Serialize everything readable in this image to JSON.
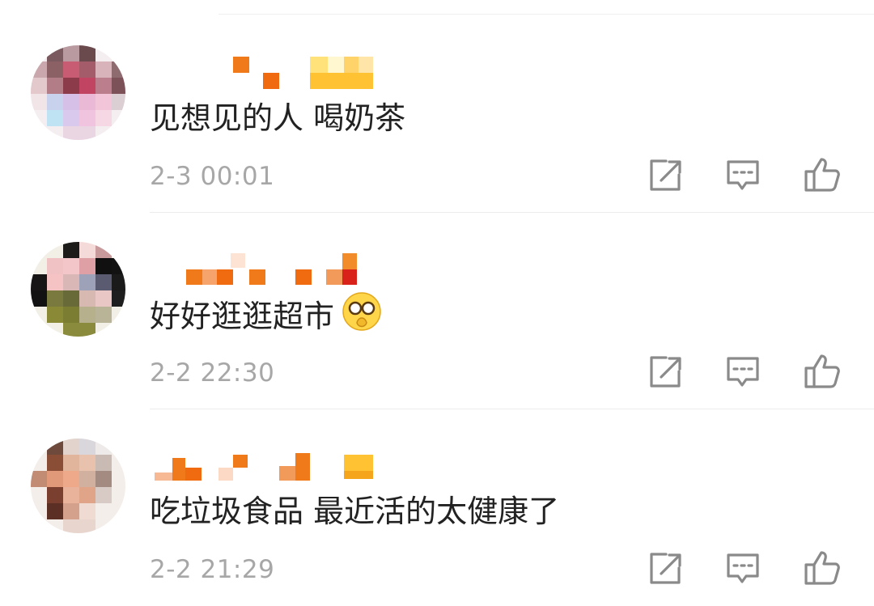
{
  "comments": [
    {
      "text": "见想见的人 喝奶茶",
      "timestamp": "2-3 00:01",
      "emoji": ""
    },
    {
      "text": "好好逛逛超市",
      "timestamp": "2-2 22:30",
      "emoji": "facepalm-emoji"
    },
    {
      "text": "吃垃圾食品 最近活的太健康了",
      "timestamp": "2-2 21:29",
      "emoji": ""
    }
  ],
  "icons": {
    "share": "share-icon",
    "reply": "comment-icon",
    "like": "thumbs-up-icon"
  },
  "colors": {
    "text": "#222222",
    "timestamp": "#a7a7a7",
    "icon": "#8a8a8a",
    "username_orange": "#f07a1a",
    "username_yellow": "#ffc233"
  }
}
